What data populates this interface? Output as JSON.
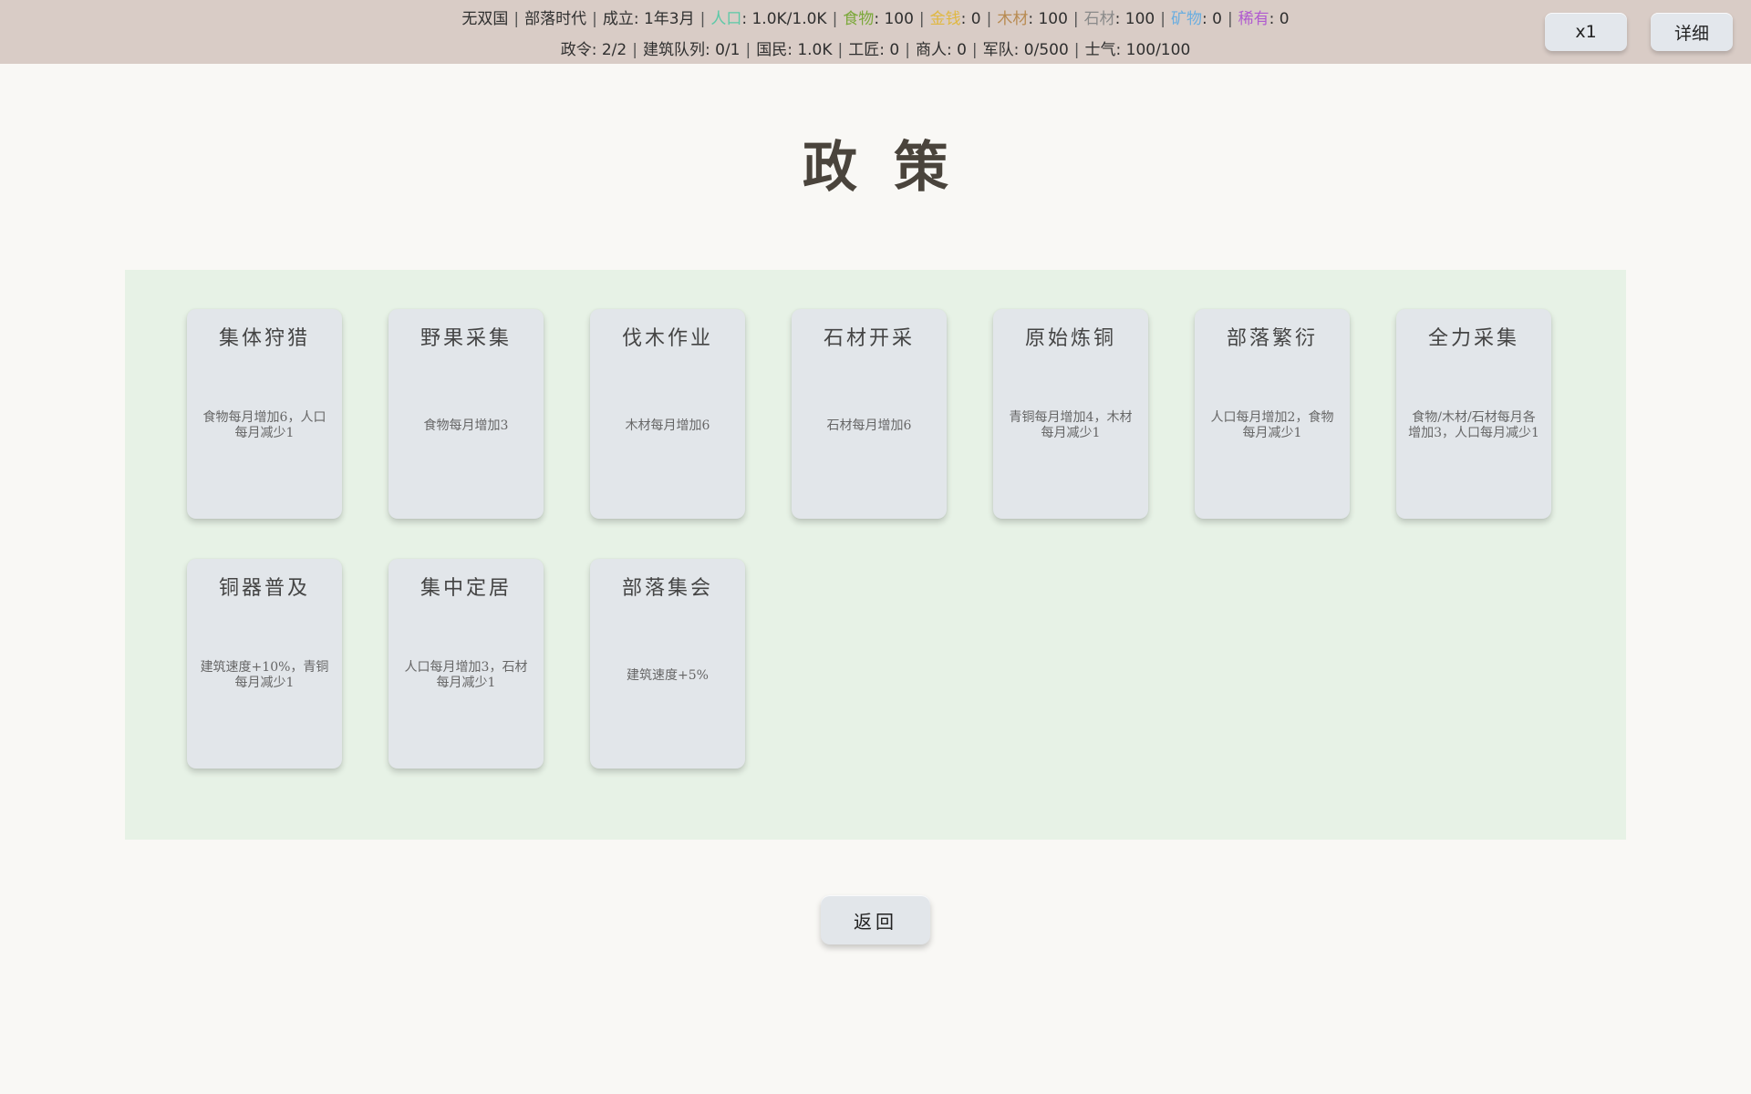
{
  "status": {
    "line1": [
      {
        "label": "无双国",
        "value": "",
        "color": "#2f2f2f"
      },
      {
        "label": "部落时代",
        "value": "",
        "color": "#2f2f2f"
      },
      {
        "label": "成立",
        "value": ": 1年3月",
        "color": "#2f2f2f"
      },
      {
        "label": "人口",
        "value": ": 1.0K/1.0K",
        "color": "#5cc9a7"
      },
      {
        "label": "食物",
        "value": ": 100",
        "color": "#7ba83a"
      },
      {
        "label": "金钱",
        "value": ": 0",
        "color": "#e0b840"
      },
      {
        "label": "木材",
        "value": ": 100",
        "color": "#b88a50"
      },
      {
        "label": "石材",
        "value": ": 100",
        "color": "#8a8a8a"
      },
      {
        "label": "矿物",
        "value": ": 0",
        "color": "#6aaee0"
      },
      {
        "label": "稀有",
        "value": ": 0",
        "color": "#b05ad0"
      }
    ],
    "line2": [
      {
        "label": "政令",
        "value": ": 2/2"
      },
      {
        "label": "建筑队列",
        "value": ": 0/1"
      },
      {
        "label": "国民",
        "value": ": 1.0K"
      },
      {
        "label": "工匠",
        "value": ": 0"
      },
      {
        "label": "商人",
        "value": ": 0"
      },
      {
        "label": "军队",
        "value": ": 0/500"
      },
      {
        "label": "士气",
        "value": ": 100/100"
      }
    ],
    "separator": "|"
  },
  "buttons": {
    "speed": "x1",
    "detail": "详细",
    "back": "返回"
  },
  "page": {
    "title": "政策"
  },
  "policies": [
    {
      "name": "集体狩猎",
      "desc": "食物每月增加6，人口每月减少1"
    },
    {
      "name": "野果采集",
      "desc": "食物每月增加3"
    },
    {
      "name": "伐木作业",
      "desc": "木材每月增加6"
    },
    {
      "name": "石材开采",
      "desc": "石材每月增加6"
    },
    {
      "name": "原始炼铜",
      "desc": "青铜每月增加4，木材每月减少1"
    },
    {
      "name": "部落繁衍",
      "desc": "人口每月增加2，食物每月减少1"
    },
    {
      "name": "全力采集",
      "desc": "食物/木材/石材每月各增加3，人口每月减少1"
    },
    {
      "name": "铜器普及",
      "desc": "建筑速度+10%，青铜每月减少1"
    },
    {
      "name": "集中定居",
      "desc": "人口每月增加3，石材每月减少1"
    },
    {
      "name": "部落集会",
      "desc": "建筑速度+5%"
    }
  ]
}
